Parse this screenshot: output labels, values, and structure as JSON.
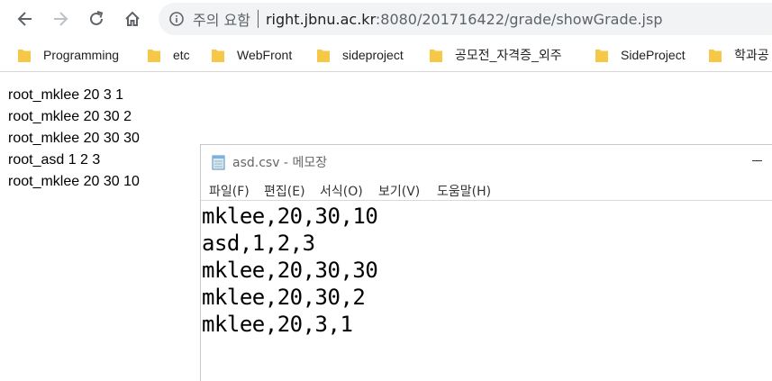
{
  "browser": {
    "security_label": "주의 요함",
    "url_host": "right.jbnu.ac.kr",
    "url_path": ":8080/201716422/grade/showGrade.jsp",
    "bookmarks": [
      {
        "label": "Programming"
      },
      {
        "label": "etc"
      },
      {
        "label": "WebFront"
      },
      {
        "label": "sideproject"
      },
      {
        "label": "공모전_자격증_외주"
      },
      {
        "label": "SideProject"
      },
      {
        "label": "학과공"
      }
    ],
    "folder_color": "#f2c94c"
  },
  "page": {
    "lines": [
      "root_mklee 20 3 1",
      "root_mklee 20 30 2",
      "root_mklee 20 30 30",
      "root_asd 1 2 3",
      "root_mklee 20 30 10"
    ]
  },
  "notepad": {
    "title": "asd.csv - 메모장",
    "menus": [
      "파일(F)",
      "편집(E)",
      "서식(O)",
      "보기(V)",
      "도움말(H)"
    ],
    "lines": [
      "mklee,20,30,10",
      "asd,1,2,3",
      "mklee,20,30,30",
      "mklee,20,30,2",
      "mklee,20,3,1"
    ]
  }
}
